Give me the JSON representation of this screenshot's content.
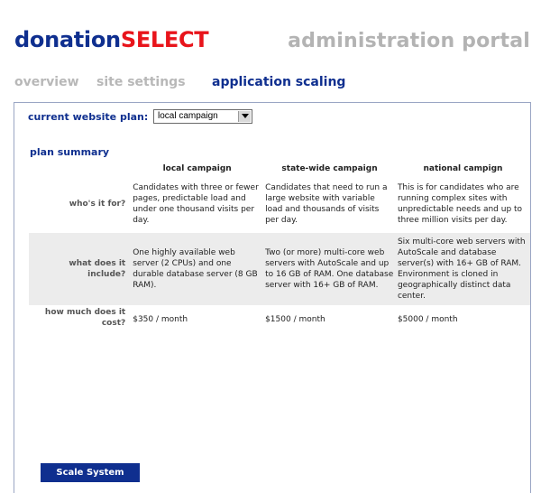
{
  "header": {
    "logo_part1": "donation",
    "logo_part2": "SELECT",
    "portal_title": "administration portal"
  },
  "tabs": [
    {
      "label": "overview",
      "active": false
    },
    {
      "label": "site settings",
      "active": false
    },
    {
      "label": "application scaling",
      "active": true
    }
  ],
  "plan_selector": {
    "label": "current website plan:",
    "selected": "local campaign"
  },
  "plan_summary": {
    "title": "plan summary",
    "columns": [
      "local campaign",
      "state-wide campaign",
      "national campign"
    ],
    "rows": [
      {
        "label": "who's it for?",
        "cells": [
          "Candidates with three or fewer pages, predictable load and under one thousand visits per day.",
          "Candidates that need to run a large website with variable load and thousands of visits per day.",
          "This is for candidates who are running complex sites with unpredictable needs and up to three million visits per day."
        ]
      },
      {
        "label": "what does it include?",
        "cells": [
          "One highly available web server (2 CPUs) and one durable database server (8 GB RAM).",
          "Two (or more) multi-core web servers with AutoScale and up to 16 GB of RAM. One database server with 16+ GB of RAM.",
          "Six multi-core web servers with AutoScale and database server(s) with 16+ GB of RAM. Environment is cloned in geographically distinct data center."
        ]
      },
      {
        "label": "how much does it cost?",
        "cells": [
          "$350 / month",
          "$1500 / month",
          "$5000 / month"
        ]
      }
    ]
  },
  "actions": {
    "scale_label": "Scale System"
  },
  "colors": {
    "brand_blue": "#0f2f8f",
    "brand_red": "#e8141b",
    "muted_gray": "#b3b3b3",
    "row_shade": "#ececec"
  }
}
